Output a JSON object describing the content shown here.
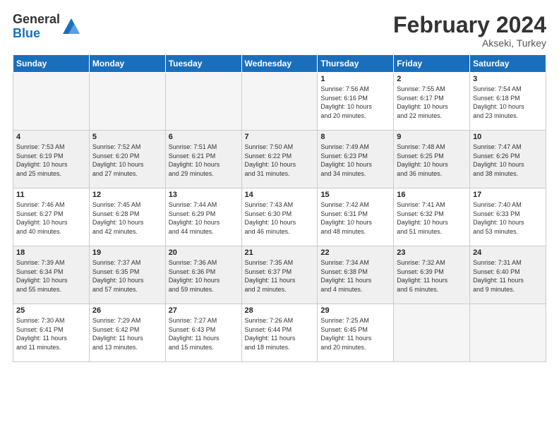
{
  "logo": {
    "general": "General",
    "blue": "Blue"
  },
  "title": "February 2024",
  "location": "Akseki, Turkey",
  "days": [
    "Sunday",
    "Monday",
    "Tuesday",
    "Wednesday",
    "Thursday",
    "Friday",
    "Saturday"
  ],
  "weeks": [
    [
      {
        "num": "",
        "info": "",
        "empty": true
      },
      {
        "num": "",
        "info": "",
        "empty": true
      },
      {
        "num": "",
        "info": "",
        "empty": true
      },
      {
        "num": "",
        "info": "",
        "empty": true
      },
      {
        "num": "1",
        "info": "Sunrise: 7:56 AM\nSunset: 6:16 PM\nDaylight: 10 hours\nand 20 minutes."
      },
      {
        "num": "2",
        "info": "Sunrise: 7:55 AM\nSunset: 6:17 PM\nDaylight: 10 hours\nand 22 minutes."
      },
      {
        "num": "3",
        "info": "Sunrise: 7:54 AM\nSunset: 6:18 PM\nDaylight: 10 hours\nand 23 minutes."
      }
    ],
    [
      {
        "num": "4",
        "info": "Sunrise: 7:53 AM\nSunset: 6:19 PM\nDaylight: 10 hours\nand 25 minutes."
      },
      {
        "num": "5",
        "info": "Sunrise: 7:52 AM\nSunset: 6:20 PM\nDaylight: 10 hours\nand 27 minutes."
      },
      {
        "num": "6",
        "info": "Sunrise: 7:51 AM\nSunset: 6:21 PM\nDaylight: 10 hours\nand 29 minutes."
      },
      {
        "num": "7",
        "info": "Sunrise: 7:50 AM\nSunset: 6:22 PM\nDaylight: 10 hours\nand 31 minutes."
      },
      {
        "num": "8",
        "info": "Sunrise: 7:49 AM\nSunset: 6:23 PM\nDaylight: 10 hours\nand 34 minutes."
      },
      {
        "num": "9",
        "info": "Sunrise: 7:48 AM\nSunset: 6:25 PM\nDaylight: 10 hours\nand 36 minutes."
      },
      {
        "num": "10",
        "info": "Sunrise: 7:47 AM\nSunset: 6:26 PM\nDaylight: 10 hours\nand 38 minutes."
      }
    ],
    [
      {
        "num": "11",
        "info": "Sunrise: 7:46 AM\nSunset: 6:27 PM\nDaylight: 10 hours\nand 40 minutes."
      },
      {
        "num": "12",
        "info": "Sunrise: 7:45 AM\nSunset: 6:28 PM\nDaylight: 10 hours\nand 42 minutes."
      },
      {
        "num": "13",
        "info": "Sunrise: 7:44 AM\nSunset: 6:29 PM\nDaylight: 10 hours\nand 44 minutes."
      },
      {
        "num": "14",
        "info": "Sunrise: 7:43 AM\nSunset: 6:30 PM\nDaylight: 10 hours\nand 46 minutes."
      },
      {
        "num": "15",
        "info": "Sunrise: 7:42 AM\nSunset: 6:31 PM\nDaylight: 10 hours\nand 48 minutes."
      },
      {
        "num": "16",
        "info": "Sunrise: 7:41 AM\nSunset: 6:32 PM\nDaylight: 10 hours\nand 51 minutes."
      },
      {
        "num": "17",
        "info": "Sunrise: 7:40 AM\nSunset: 6:33 PM\nDaylight: 10 hours\nand 53 minutes."
      }
    ],
    [
      {
        "num": "18",
        "info": "Sunrise: 7:39 AM\nSunset: 6:34 PM\nDaylight: 10 hours\nand 55 minutes."
      },
      {
        "num": "19",
        "info": "Sunrise: 7:37 AM\nSunset: 6:35 PM\nDaylight: 10 hours\nand 57 minutes."
      },
      {
        "num": "20",
        "info": "Sunrise: 7:36 AM\nSunset: 6:36 PM\nDaylight: 10 hours\nand 59 minutes."
      },
      {
        "num": "21",
        "info": "Sunrise: 7:35 AM\nSunset: 6:37 PM\nDaylight: 11 hours\nand 2 minutes."
      },
      {
        "num": "22",
        "info": "Sunrise: 7:34 AM\nSunset: 6:38 PM\nDaylight: 11 hours\nand 4 minutes."
      },
      {
        "num": "23",
        "info": "Sunrise: 7:32 AM\nSunset: 6:39 PM\nDaylight: 11 hours\nand 6 minutes."
      },
      {
        "num": "24",
        "info": "Sunrise: 7:31 AM\nSunset: 6:40 PM\nDaylight: 11 hours\nand 9 minutes."
      }
    ],
    [
      {
        "num": "25",
        "info": "Sunrise: 7:30 AM\nSunset: 6:41 PM\nDaylight: 11 hours\nand 11 minutes."
      },
      {
        "num": "26",
        "info": "Sunrise: 7:29 AM\nSunset: 6:42 PM\nDaylight: 11 hours\nand 13 minutes."
      },
      {
        "num": "27",
        "info": "Sunrise: 7:27 AM\nSunset: 6:43 PM\nDaylight: 11 hours\nand 15 minutes."
      },
      {
        "num": "28",
        "info": "Sunrise: 7:26 AM\nSunset: 6:44 PM\nDaylight: 11 hours\nand 18 minutes."
      },
      {
        "num": "29",
        "info": "Sunrise: 7:25 AM\nSunset: 6:45 PM\nDaylight: 11 hours\nand 20 minutes."
      },
      {
        "num": "",
        "info": "",
        "empty": true
      },
      {
        "num": "",
        "info": "",
        "empty": true
      }
    ]
  ]
}
